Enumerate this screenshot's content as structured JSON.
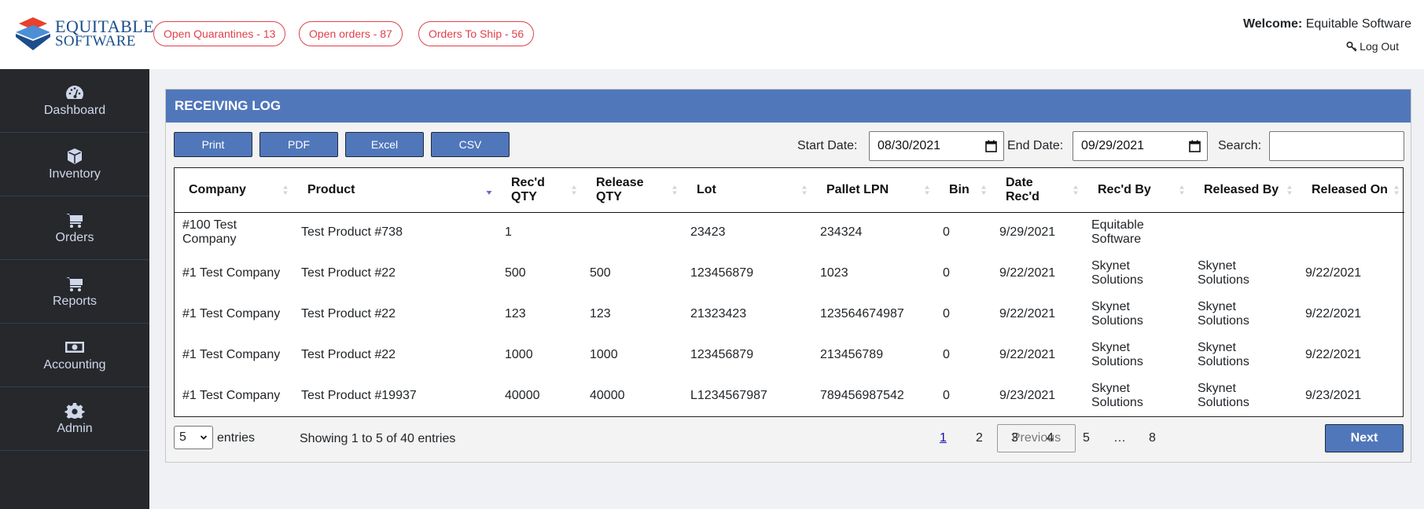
{
  "brand": {
    "line1": "EQUITABLE",
    "line2": "SOFTWARE"
  },
  "header": {
    "pills": [
      {
        "label": "Open Quarantines - 13"
      },
      {
        "label": "Open orders - 87"
      },
      {
        "label": "Orders To Ship - 56"
      }
    ],
    "welcome_label": "Welcome:",
    "welcome_user": "Equitable Software",
    "logout_label": "Log Out",
    "accent_color": "#e0414c"
  },
  "sidebar": {
    "items": [
      {
        "label": "Dashboard",
        "icon": "dashboard-icon"
      },
      {
        "label": "Inventory",
        "icon": "box-icon"
      },
      {
        "label": "Orders",
        "icon": "cart-icon"
      },
      {
        "label": "Reports",
        "icon": "cart-icon"
      },
      {
        "label": "Accounting",
        "icon": "money-icon"
      },
      {
        "label": "Admin",
        "icon": "gear-icon"
      }
    ]
  },
  "main": {
    "title": "RECEIVING LOG",
    "buttons": {
      "print": "Print",
      "pdf": "PDF",
      "excel": "Excel",
      "csv": "CSV"
    },
    "filters": {
      "start_label": "Start Date:",
      "start_value": "08/30/2021",
      "end_label": "End Date:",
      "end_value": "09/29/2021",
      "search_label": "Search:",
      "search_value": ""
    },
    "table": {
      "columns": [
        "Company",
        "Product",
        "Rec'd QTY",
        "Release QTY",
        "Lot",
        "Pallet LPN",
        "Bin",
        "Date Rec'd",
        "Rec'd By",
        "Released By",
        "Released On"
      ],
      "sorted_column": "Product",
      "sort_direction": "descending",
      "rows": [
        [
          "#100 Test Company",
          "Test Product #738",
          "1",
          "",
          "23423",
          "234324",
          "0",
          "9/29/2021",
          "Equitable Software",
          "",
          ""
        ],
        [
          "#1 Test Company",
          "Test Product #22",
          "500",
          "500",
          "123456879",
          "1023",
          "0",
          "9/22/2021",
          "Skynet Solutions",
          "Skynet Solutions",
          "9/22/2021"
        ],
        [
          "#1 Test Company",
          "Test Product #22",
          "123",
          "123",
          "21323423",
          "123564674987",
          "0",
          "9/22/2021",
          "Skynet Solutions",
          "Skynet Solutions",
          "9/22/2021"
        ],
        [
          "#1 Test Company",
          "Test Product #22",
          "1000",
          "1000",
          "123456879",
          "213456789",
          "0",
          "9/22/2021",
          "Skynet Solutions",
          "Skynet Solutions",
          "9/22/2021"
        ],
        [
          "#1 Test Company",
          "Test Product #19937",
          "40000",
          "40000",
          "L1234567987",
          "789456987542",
          "0",
          "9/23/2021",
          "Skynet Solutions",
          "Skynet Solutions",
          "9/23/2021"
        ]
      ]
    },
    "footer": {
      "page_length": "5",
      "entries_label": "entries",
      "info": "Showing 1 to 5 of 40 entries",
      "previous_label": "Previous",
      "next_label": "Next",
      "pages": [
        "1",
        "2",
        "3",
        "4",
        "5",
        "…",
        "8"
      ],
      "current_page": "1"
    },
    "header_color": "#5177bb"
  }
}
